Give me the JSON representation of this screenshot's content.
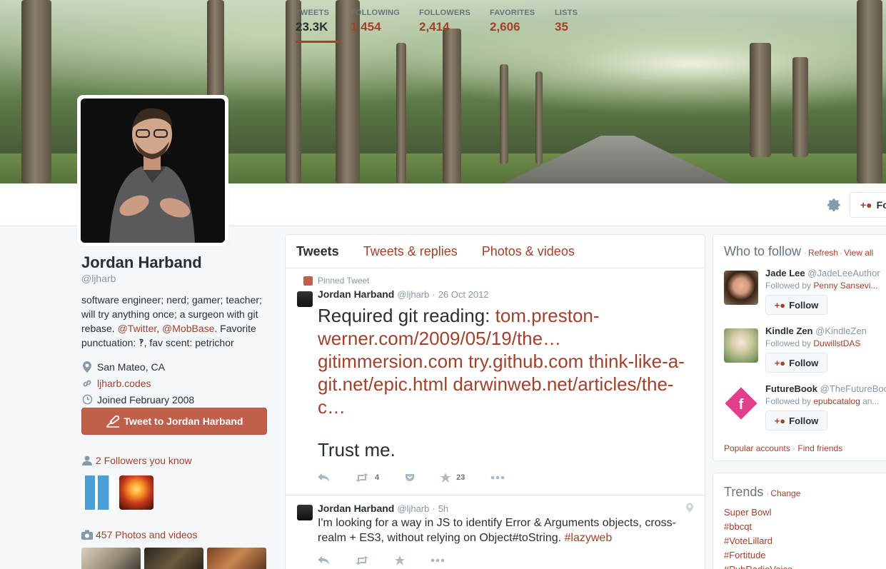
{
  "profile": {
    "name": "Jordan Harband",
    "handle": "@ljharb",
    "bio_pre": "software engineer; nerd; gamer; teacher; will try anything once; a surgeon with git rebase.",
    "bio_link1": "@Twitter",
    "bio_sep": ", ",
    "bio_link2": "@MobBase",
    "bio_post": ". Favorite punctuation: ‽, fav scent: petrichor",
    "location": "San Mateo, CA",
    "website": "ljharb.codes",
    "joined": "Joined February 2008",
    "tweet_to_label": "Tweet to Jordan Harband",
    "followers_you_know": "2 Followers you know",
    "photos_videos": "457 Photos and videos"
  },
  "stats": [
    {
      "label": "TWEETS",
      "value": "23.3K"
    },
    {
      "label": "FOLLOWING",
      "value": "1,454"
    },
    {
      "label": "FOLLOWERS",
      "value": "2,414"
    },
    {
      "label": "FAVORITES",
      "value": "2,606"
    },
    {
      "label": "LISTS",
      "value": "35"
    }
  ],
  "follow_top_label": "Fo",
  "tabs": [
    "Tweets",
    "Tweets & replies",
    "Photos & videos"
  ],
  "tweets": [
    {
      "pinned_label": "Pinned Tweet",
      "name": "Jordan Harband",
      "handle": "@ljharb",
      "sep": "·",
      "time": "26 Oct 2012",
      "text_pre": "Required git reading: ",
      "links": [
        "tom.preston-werner.com/2009/05/19/the…",
        "gitimmersion.com",
        "try.github.com",
        "think-like-a-git.net/epic.html",
        "darwinweb.net/articles/the-c…"
      ],
      "text_post": "Trust me.",
      "retweets": "4",
      "favorites": "23"
    },
    {
      "name": "Jordan Harband",
      "handle": "@ljharb",
      "sep": "·",
      "time": "5h",
      "text": "I'm looking for a way in JS to identify Error & Arguments objects, cross-realm + ES3, without relying on Object#toString. ",
      "hashtag": "#lazyweb"
    }
  ],
  "who_to_follow": {
    "title": "Who to follow",
    "sep": "·",
    "refresh": "Refresh",
    "view_all": "View all",
    "follow_label": "Follow",
    "suggestions": [
      {
        "name": "Jade Lee",
        "handle": "@JadeLeeAuthor",
        "followed_by_pre": "Followed by",
        "followed_by": "Penny Sansevi..."
      },
      {
        "name": "Kindle Zen",
        "handle": "@KindleZen",
        "followed_by_pre": "Followed by",
        "followed_by": "DuwillstDAS"
      },
      {
        "name": "FutureBook",
        "handle": "@TheFutureBoo",
        "followed_by_pre": "Followed by",
        "followed_by": "epubcatalog",
        "followed_by_post": "an..."
      }
    ],
    "popular": "Popular accounts",
    "find_friends": "Find friends"
  },
  "trends": {
    "title": "Trends",
    "sep": "·",
    "change": "Change",
    "items": [
      "Super Bowl",
      "#bbcqt",
      "#VoteLillard",
      "#Fortitude",
      "#PubRadioVoice"
    ]
  },
  "colors": {
    "accent": "#a0412b",
    "button": "#c0604a",
    "muted": "#8899a6"
  }
}
